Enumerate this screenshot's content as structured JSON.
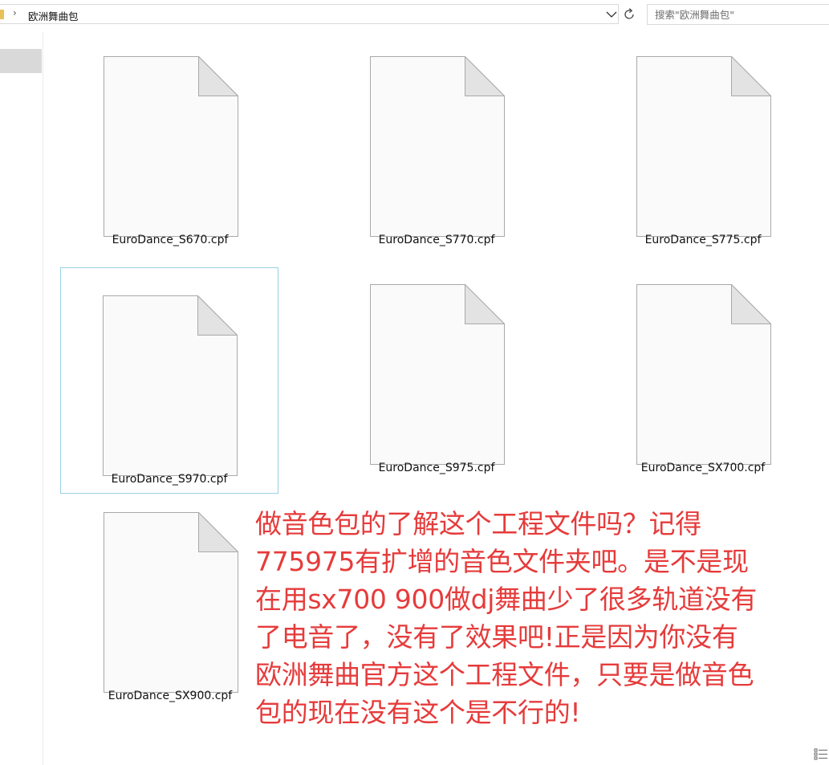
{
  "address_bar": {
    "breadcrumb_separator": "›",
    "current_folder": "欧洲舞曲包"
  },
  "search": {
    "placeholder": "搜索\"欧洲舞曲包\""
  },
  "files": [
    {
      "name": "EuroDance_S670.cpf",
      "selected": false
    },
    {
      "name": "EuroDance_S770.cpf",
      "selected": false
    },
    {
      "name": "EuroDance_S775.cpf",
      "selected": false
    },
    {
      "name": "EuroDance_S970.cpf",
      "selected": true
    },
    {
      "name": "EuroDance_S975.cpf",
      "selected": false
    },
    {
      "name": "EuroDance_SX700.cpf",
      "selected": false
    },
    {
      "name": "EuroDance_SX900.cpf",
      "selected": false
    }
  ],
  "annotation": {
    "lines": [
      "做音色包的了解这个工程文件吗？记得",
      "775975有扩增的音色文件夹吧。是不是现",
      "在用sx700 900做dj舞曲少了很多轨道没有",
      "了电音了，没有了效果吧!正是因为你没有",
      "欧洲舞曲官方这个工程文件，只要是做音色",
      "包的现在没有这个是不行的!"
    ],
    "color": "#e63b3b"
  },
  "icons": {
    "file": "blank-document-icon",
    "dropdown": "chevron-down-icon",
    "refresh": "refresh-icon",
    "view": "details-view-icon"
  },
  "colors": {
    "selection_border": "#99d1e4",
    "nav_highlight": "#d9d9d9"
  }
}
